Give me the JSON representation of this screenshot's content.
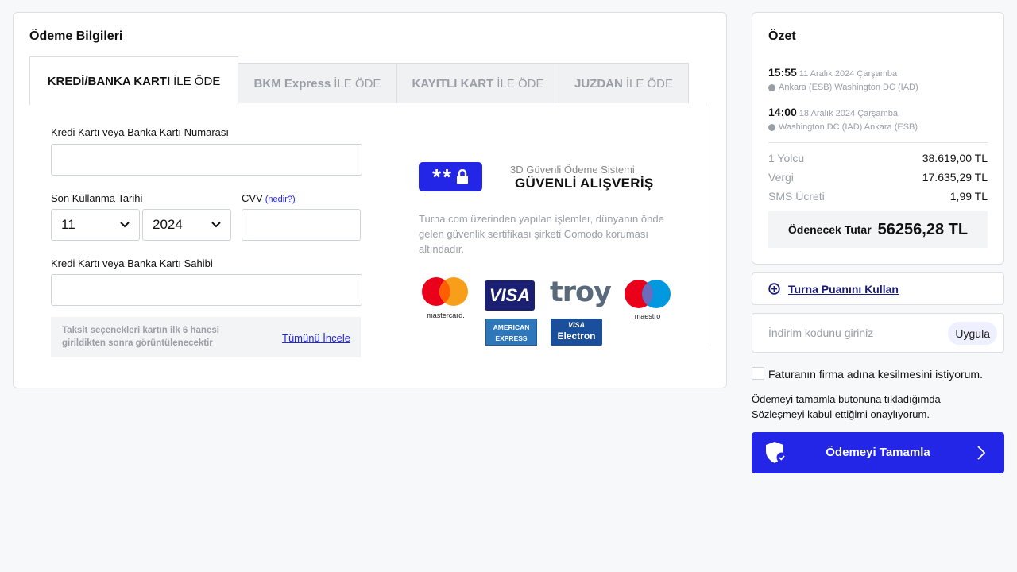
{
  "payment": {
    "title": "Ödeme Bilgileri",
    "tabs": [
      {
        "bold": "KREDİ/BANKA KARTI",
        "rest": "İLE ÖDE"
      },
      {
        "bold": "BKM Express",
        "rest": "İLE ÖDE"
      },
      {
        "bold": "KAYITLI KART",
        "rest": "İLE ÖDE"
      },
      {
        "bold": "JUZDAN",
        "rest": "İLE ÖDE"
      }
    ],
    "card_number_label": "Kredi Kartı veya Banka Kartı Numarası",
    "card_number_value": "",
    "expiry_label": "Son Kullanma Tarihi",
    "expiry_month": "11",
    "expiry_year": "2024",
    "cvv_label": "CVV",
    "cvv_help": "(nedir?)",
    "cvv_value": "",
    "holder_label": "Kredi Kartı veya Banka Kartı Sahibi",
    "holder_value": "",
    "installment_text": "Taksit seçenekleri kartın ilk 6 hanesi girildikten sonra görüntülenecektir",
    "installment_link": "Tümünü İncele"
  },
  "security": {
    "badge": "**",
    "subtitle": "3D Güvenli Ödeme Sistemi",
    "title": "GÜVENLİ ALIŞVERİŞ",
    "description": "Turna.com üzerinden yapılan işlemler, dünyanın önde gelen güvenlik sertifikası şirketi Comodo koruması altındadır.",
    "logos": {
      "mastercard": "mastercard.",
      "visa": "VISA",
      "troy": "troy",
      "maestro": "maestro",
      "amex_1": "AMERICAN",
      "amex_2": "EXPRESS",
      "visa_electron_1": "VISA",
      "visa_electron_2": "Electron"
    }
  },
  "summary": {
    "title": "Özet",
    "outbound": {
      "time": "15:55",
      "date": "11 Aralık 2024 Çarşamba",
      "route": "Ankara (ESB) Washington DC (IAD)"
    },
    "return": {
      "time": "14:00",
      "date": "18 Aralık 2024 Çarşamba",
      "route": "Washington DC (IAD) Ankara (ESB)"
    },
    "rows": [
      {
        "label": "1 Yolcu",
        "value": "38.619,00 TL"
      },
      {
        "label": "Vergi",
        "value": "17.635,29 TL"
      },
      {
        "label": "SMS Ücreti",
        "value": "1,99 TL"
      }
    ],
    "total_label": "Ödenecek Tutar",
    "total_value": "56256,28 TL"
  },
  "points": {
    "label": "Turna Puanını Kullan"
  },
  "discount": {
    "placeholder": "İndirim kodunu giriniz",
    "apply": "Uygula"
  },
  "invoice": {
    "label": "Faturanın firma adına kesilmesini istiyorum."
  },
  "terms": {
    "before": "Ödemeyi tamamla butonuna tıkladığımda",
    "link": "Sözleşmeyi",
    "after": " kabul ettiğimi onaylıyorum."
  },
  "pay_button": {
    "label": "Ödemeyi Tamamla"
  },
  "colors": {
    "accent": "#2326e6",
    "background": "#f6f8fa"
  }
}
